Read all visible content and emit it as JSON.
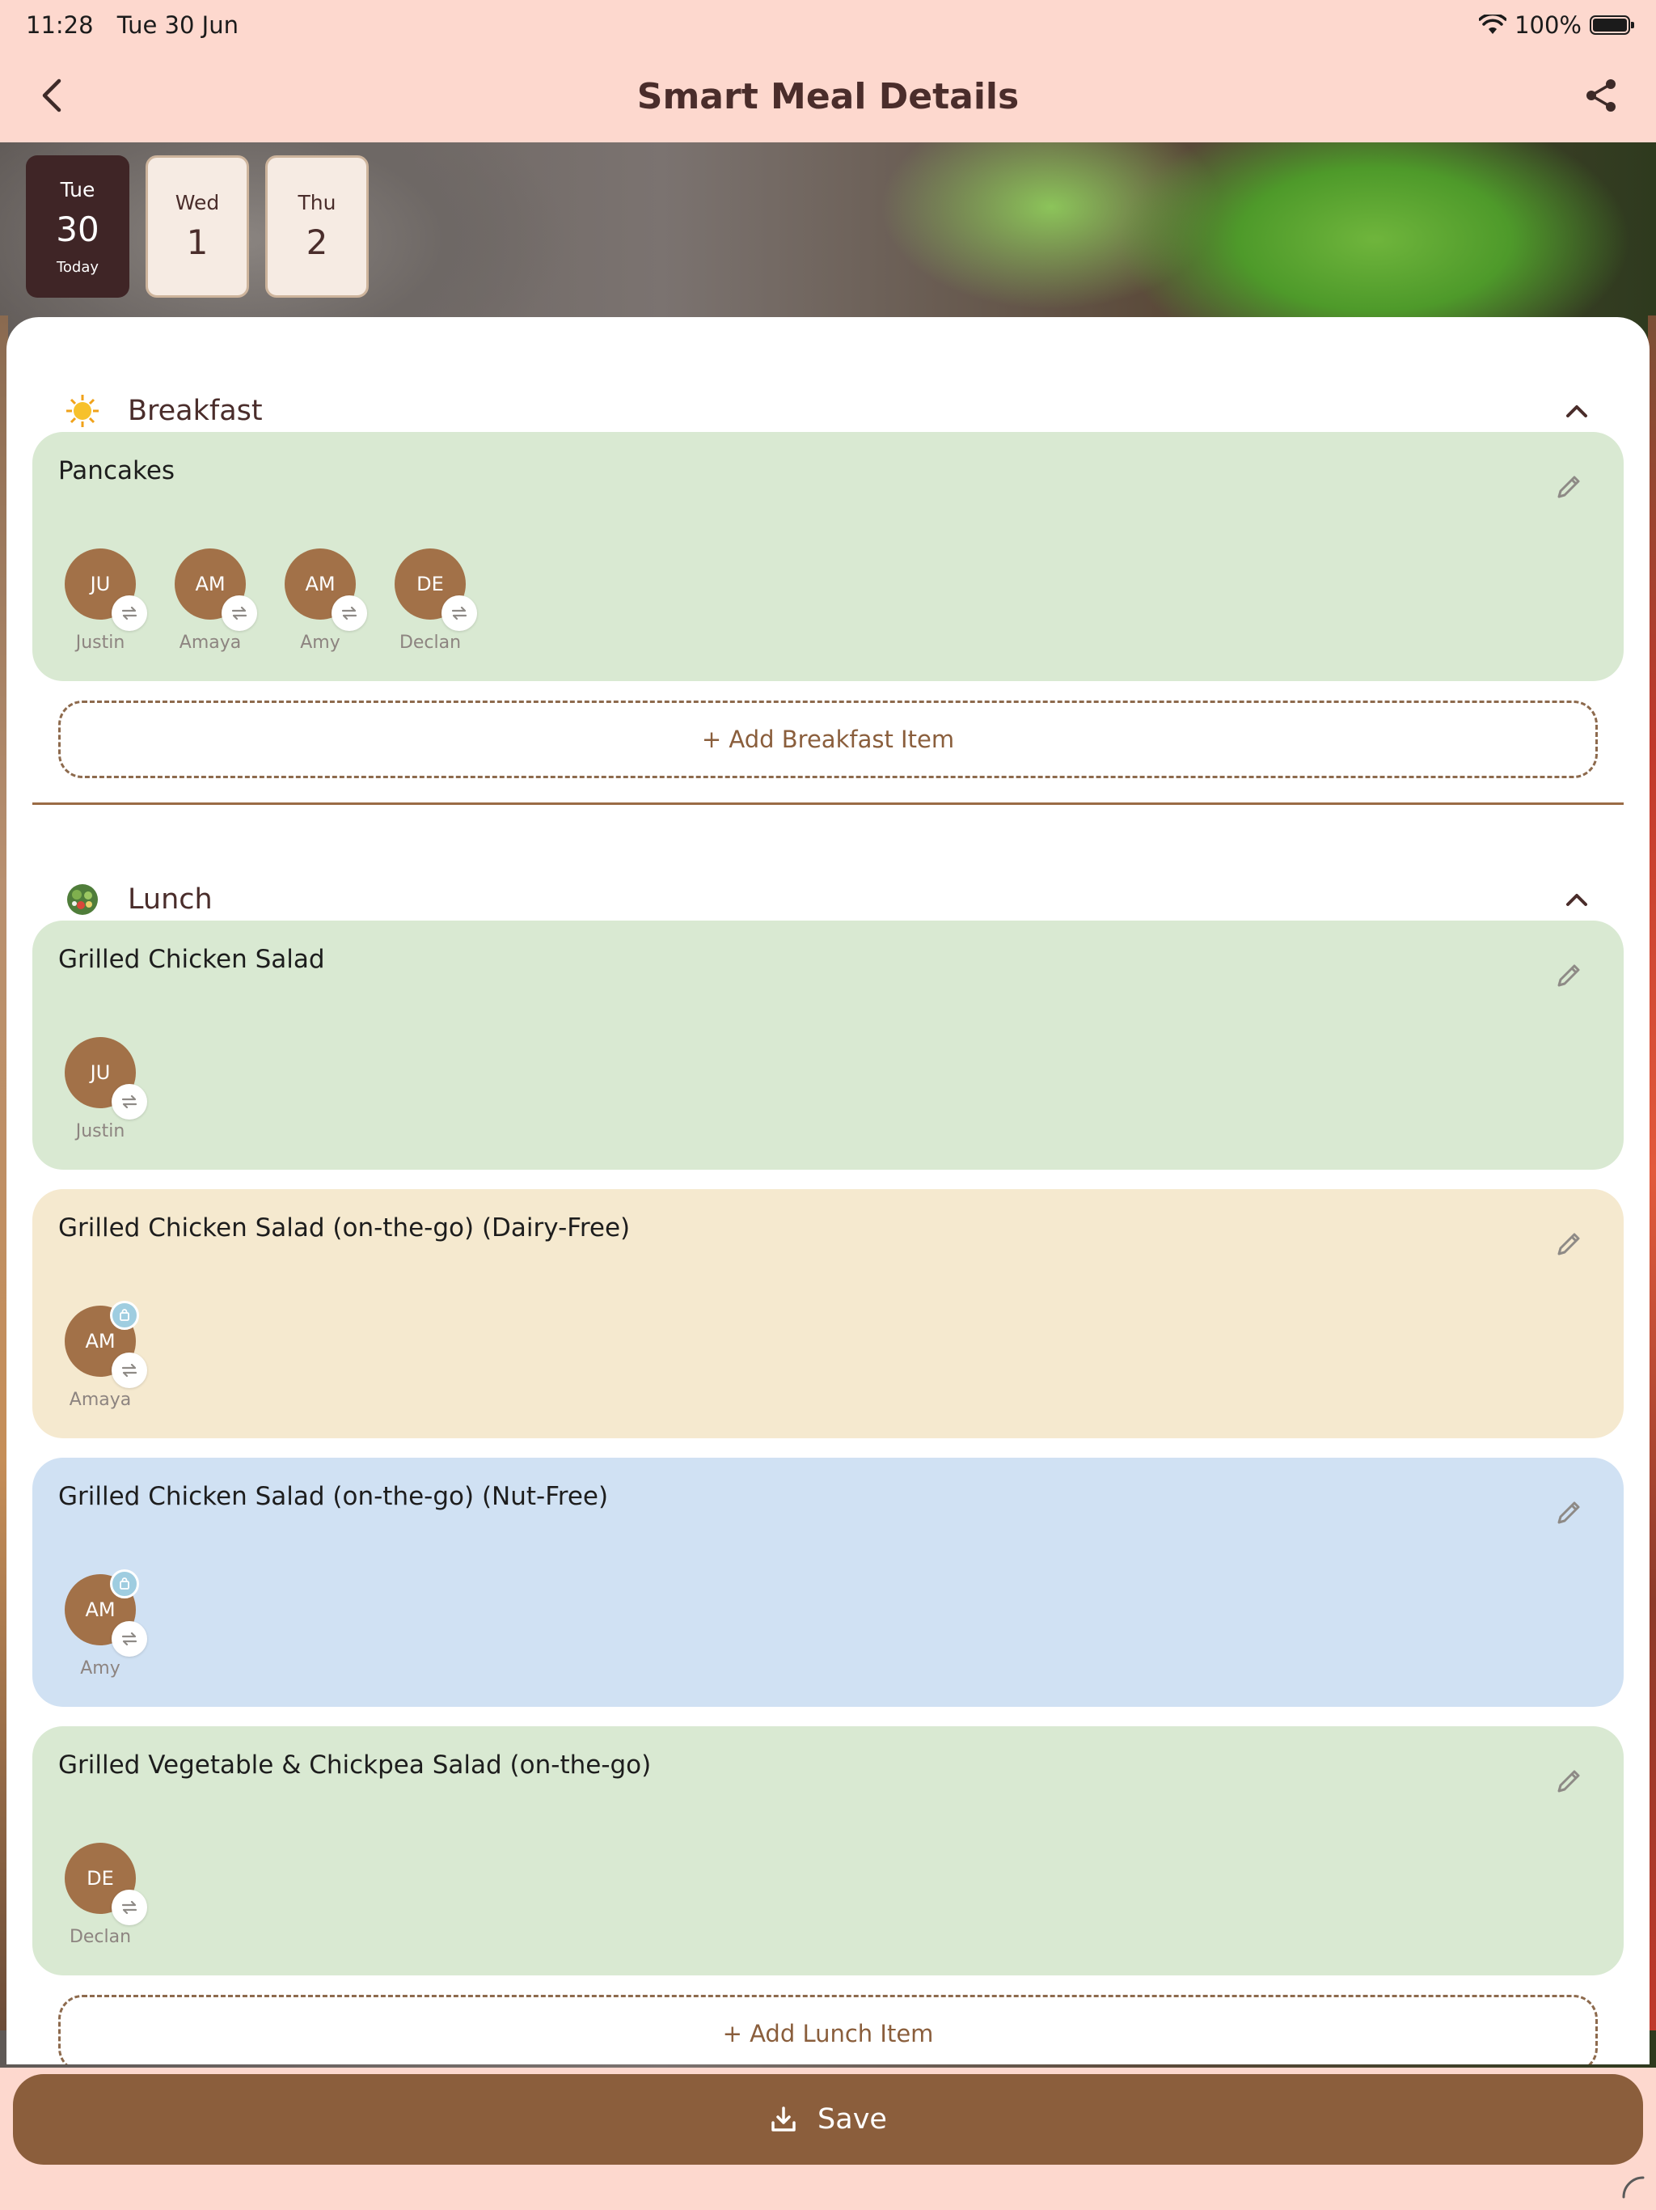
{
  "status_bar": {
    "time": "11:28",
    "date": "Tue 30 Jun",
    "battery": "100%"
  },
  "nav": {
    "title": "Smart Meal Details"
  },
  "days": [
    {
      "name": "Tue",
      "num": "30",
      "sub": "Today"
    },
    {
      "name": "Wed",
      "num": "1"
    },
    {
      "name": "Thu",
      "num": "2"
    }
  ],
  "breakfast": {
    "title": "Breakfast",
    "icon": "sun-icon",
    "card": {
      "title": "Pancakes",
      "people": [
        {
          "initials": "JU",
          "name": "Justin"
        },
        {
          "initials": "AM",
          "name": "Amaya"
        },
        {
          "initials": "AM",
          "name": "Amy"
        },
        {
          "initials": "DE",
          "name": "Declan"
        }
      ]
    },
    "add_label": "+ Add Breakfast Item"
  },
  "lunch": {
    "title": "Lunch",
    "icon": "salad-icon",
    "cards": [
      {
        "title": "Grilled Chicken Salad",
        "people": [
          {
            "initials": "JU",
            "name": "Justin"
          }
        ]
      },
      {
        "title": "Grilled Chicken Salad (on-the-go) (Dairy-Free)",
        "people": [
          {
            "initials": "AM",
            "name": "Amaya"
          }
        ]
      },
      {
        "title": "Grilled Chicken Salad (on-the-go) (Nut-Free)",
        "people": [
          {
            "initials": "AM",
            "name": "Amy"
          }
        ]
      },
      {
        "title": "Grilled Vegetable & Chickpea Salad (on-the-go)",
        "people": [
          {
            "initials": "DE",
            "name": "Declan"
          }
        ]
      }
    ],
    "add_label": "+ Add Lunch Item"
  },
  "save_label": "Save",
  "colors": {
    "accent": "#8b5e3c",
    "header_bg": "#fdd8ce",
    "avatar": "#a27148",
    "selected_day": "#3f2526"
  }
}
